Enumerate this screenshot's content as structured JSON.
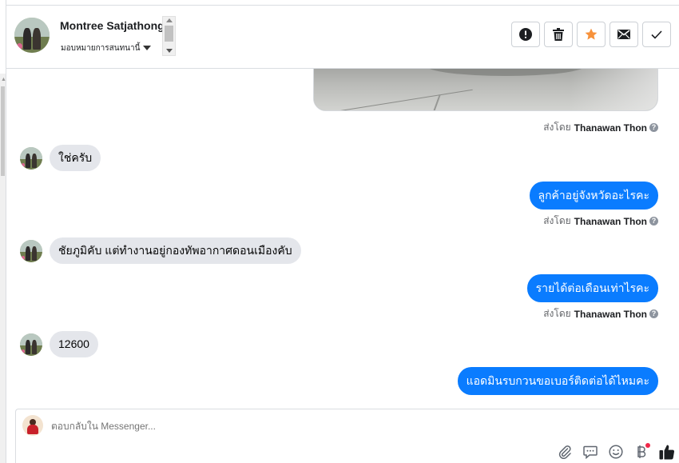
{
  "header": {
    "contact_name": "Montree Satjathong",
    "assign_label": "มอบหมายการสนทนานี้",
    "actions": [
      {
        "name": "report-button",
        "icon": "exclamation-icon"
      },
      {
        "name": "delete-button",
        "icon": "trash-icon"
      },
      {
        "name": "star-button",
        "icon": "star-icon",
        "color": "#f7923b"
      },
      {
        "name": "mark-unread-button",
        "icon": "envelope-icon"
      },
      {
        "name": "mark-done-button",
        "icon": "checkmark-icon"
      }
    ]
  },
  "conversation": {
    "sent_by_prefix": "ส่งโดย",
    "sender_name": "Thanawan Thon",
    "messages": [
      {
        "direction": "in",
        "text": "ใช่ครับ"
      },
      {
        "direction": "out",
        "text": "ลูกค้าอยู่จังหวัดอะไรคะ"
      },
      {
        "direction": "in",
        "text": "ชัยภูมิคับ แต่ทำงานอยู่กองทัพอากาศดอนเมืองคับ"
      },
      {
        "direction": "out",
        "text": "รายได้ต่อเดือนเท่าไรคะ"
      },
      {
        "direction": "in",
        "text": "12600"
      },
      {
        "direction": "out",
        "text": "แอดมินรบกวนขอเบอร์ติดต่อได้ไหมคะ"
      }
    ]
  },
  "composer": {
    "placeholder": "ตอบกลับใน Messenger...",
    "tools": [
      "paperclip-icon",
      "saved-reply-icon",
      "emoji-icon",
      "baht-icon",
      "thumbs-up-icon"
    ]
  },
  "colors": {
    "outgoing_bubble": "#0a7cff",
    "incoming_bubble": "#e4e6eb",
    "notification_dot": "#f02849"
  }
}
